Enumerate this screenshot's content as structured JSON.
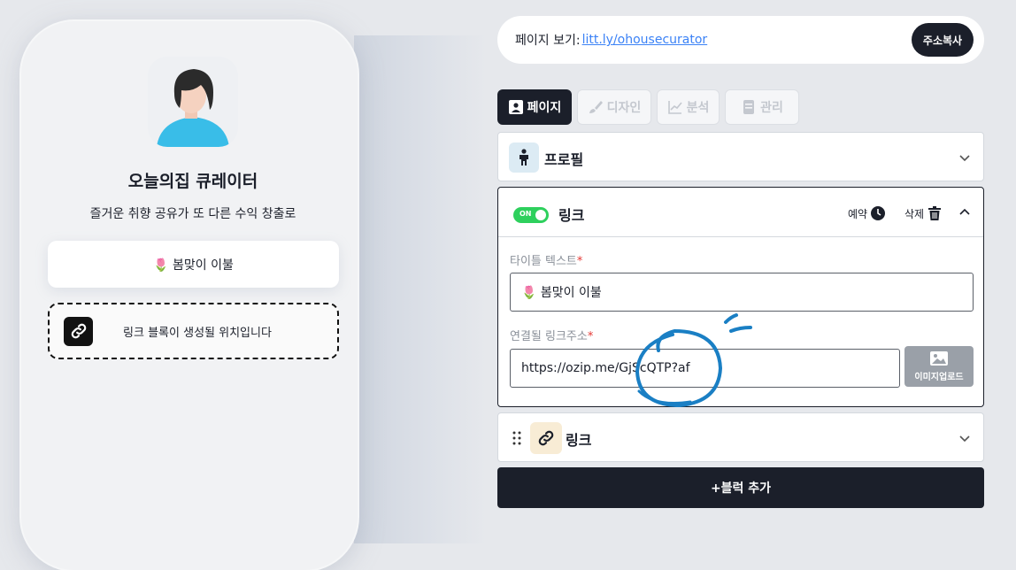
{
  "profile": {
    "name": "오늘의집 큐레이터",
    "bio": "즐거운 취향 공유가 또 다른 수익 창출로"
  },
  "preview": {
    "link_button_label": "🌷 봄맞이 이불",
    "placeholder_text": "링크 블록이 생성될 위치입니다"
  },
  "page_url": {
    "label": "페이지 보기:",
    "url": "litt.ly/ohousecurator",
    "copy_button": "주소복사"
  },
  "tabs": [
    {
      "label": "페이지",
      "icon": "person-card-icon",
      "active": true
    },
    {
      "label": "디자인",
      "icon": "brush-icon",
      "active": false
    },
    {
      "label": "분석",
      "icon": "chart-line-icon",
      "active": false
    },
    {
      "label": "관리",
      "icon": "document-icon",
      "active": false
    }
  ],
  "sections": {
    "profile": {
      "title": "프로필",
      "icon": "person-icon"
    },
    "link_expanded": {
      "toggle": "ON",
      "title": "링크",
      "schedule_label": "예약",
      "delete_label": "삭제",
      "title_field": {
        "label": "타이틀 텍스트",
        "required": "*",
        "value": "🌷 봄맞이 이불"
      },
      "url_field": {
        "label": "연결될 링크주소",
        "required": "*",
        "value": "https://ozip.me/GjScQTP?af"
      },
      "upload_label": "이미지업로드"
    },
    "link_collapsed": {
      "title": "링크",
      "icon": "link-icon"
    }
  },
  "add_block_button": "+블럭 추가",
  "colors": {
    "dark": "#1b1f2a",
    "toggle_on": "#2ed05d",
    "link_blue": "#3b82f6",
    "required_red": "#e53935",
    "annotation_blue": "#1a7fc4"
  }
}
